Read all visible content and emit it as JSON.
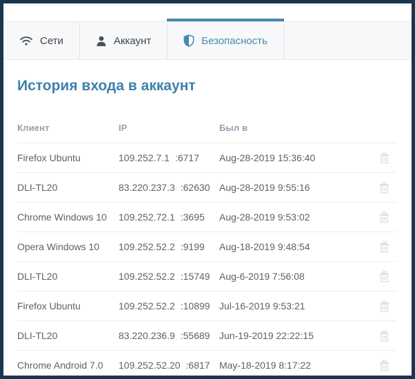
{
  "tabs": [
    {
      "label": "Сети",
      "icon": "wifi-icon",
      "active": false
    },
    {
      "label": "Аккаунт",
      "icon": "user-icon",
      "active": false
    },
    {
      "label": "Безопасность",
      "icon": "shield-icon",
      "active": true
    }
  ],
  "page": {
    "title": "История входа в аккаунт"
  },
  "table": {
    "columns": [
      "Клиент",
      "IP",
      "Был в"
    ],
    "row_action_icon": "trash-icon",
    "rows": [
      {
        "client": "Firefox Ubuntu",
        "ip": "109.252.7.1",
        "port": ":6717",
        "seen": "Aug-28-2019 15:36:40"
      },
      {
        "client": "DLI-TL20",
        "ip": "83.220.237.3",
        "port": ":62630",
        "seen": "Aug-28-2019 9:55:16"
      },
      {
        "client": "Chrome Windows 10",
        "ip": "109.252.72.1",
        "port": ":3695",
        "seen": "Aug-28-2019 9:53:02"
      },
      {
        "client": "Opera Windows 10",
        "ip": "109.252.52.2",
        "port": ":9199",
        "seen": "Aug-18-2019 9:48:54"
      },
      {
        "client": "DLI-TL20",
        "ip": "109.252.52.2",
        "port": ":15749",
        "seen": "Aug-6-2019 7:56:08"
      },
      {
        "client": "Firefox Ubuntu",
        "ip": "109.252.52.2",
        "port": ":10899",
        "seen": "Jul-16-2019 9:53:21"
      },
      {
        "client": "DLI-TL20",
        "ip": "83.220.236.9",
        "port": ":55689",
        "seen": "Jun-19-2019 22:22:15"
      },
      {
        "client": "Chrome Android 7.0",
        "ip": "109.252.52.20",
        "port": ":6817",
        "seen": "May-18-2019 8:17:22"
      }
    ]
  },
  "colors": {
    "frame_border": "#17364f",
    "accent": "#4788b0",
    "heading": "#3e80ab",
    "tab_bar_bg": "#f7f8f9",
    "table_header_text": "#919fae",
    "body_text": "#5c6166",
    "divider": "#ebedef",
    "trash_icon": "#d9e0e8"
  }
}
